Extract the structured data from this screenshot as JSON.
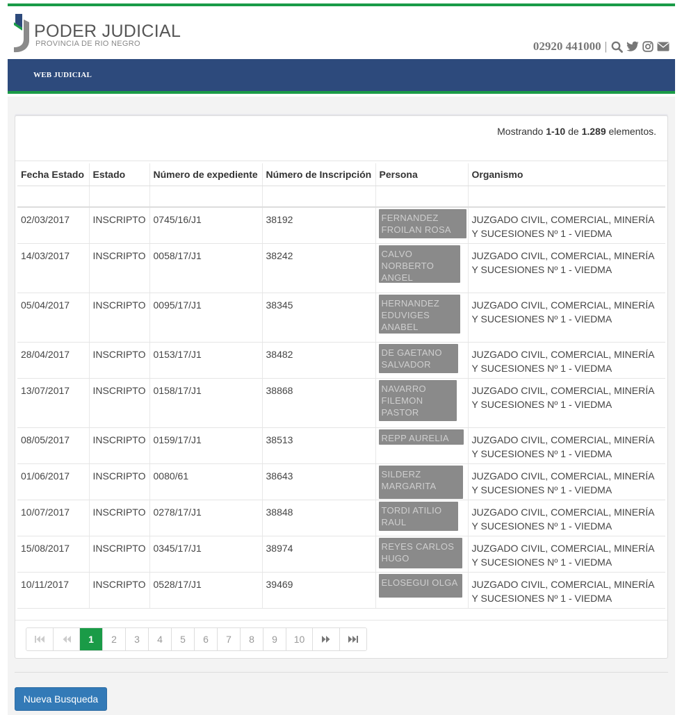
{
  "header": {
    "logo_title": "PODER JUDICIAL",
    "logo_subtitle": "PROVINCIA DE RIO NEGRO",
    "phone": "02920 441000",
    "separator": "|",
    "icons": [
      "search-icon",
      "twitter-icon",
      "instagram-icon",
      "envelope-icon"
    ]
  },
  "nav": {
    "web_judicial": "WEB JUDICIAL"
  },
  "summary": {
    "prefix": "Mostrando",
    "range": "1-10",
    "middle": "de",
    "total": "1.289",
    "suffix": "elementos."
  },
  "table": {
    "columns": [
      "Fecha Estado",
      "Estado",
      "Número de expediente",
      "Número de Inscripción",
      "Persona",
      "Organismo"
    ],
    "rows": [
      {
        "fecha": "02/03/2017",
        "estado": "INSCRIPTO",
        "expediente": "0745/16/J1",
        "inscripcion": "38192",
        "persona": "FERNANDEZ FROILAN ROSA",
        "organismo": "JUZGADO CIVIL, COMERCIAL, MINERÍA Y SUCESIONES Nº 1 - VIEDMA"
      },
      {
        "fecha": "14/03/2017",
        "estado": "INSCRIPTO",
        "expediente": "0058/17/J1",
        "inscripcion": "38242",
        "persona": "CALVO NORBERTO ANGEL",
        "organismo": "JUZGADO CIVIL, COMERCIAL, MINERÍA Y SUCESIONES Nº 1 - VIEDMA"
      },
      {
        "fecha": "05/04/2017",
        "estado": "INSCRIPTO",
        "expediente": "0095/17/J1",
        "inscripcion": "38345",
        "persona": "HERNANDEZ EDUVIGES ANABEL",
        "organismo": "JUZGADO CIVIL, COMERCIAL, MINERÍA Y SUCESIONES Nº 1 - VIEDMA"
      },
      {
        "fecha": "28/04/2017",
        "estado": "INSCRIPTO",
        "expediente": "0153/17/J1",
        "inscripcion": "38482",
        "persona": "DE GAETANO SALVADOR",
        "organismo": "JUZGADO CIVIL, COMERCIAL, MINERÍA Y SUCESIONES Nº 1 - VIEDMA"
      },
      {
        "fecha": "13/07/2017",
        "estado": "INSCRIPTO",
        "expediente": "0158/17/J1",
        "inscripcion": "38868",
        "persona": "NAVARRO FILEMON PASTOR",
        "organismo": "JUZGADO CIVIL, COMERCIAL, MINERÍA Y SUCESIONES Nº 1 - VIEDMA"
      },
      {
        "fecha": "08/05/2017",
        "estado": "INSCRIPTO",
        "expediente": "0159/17/J1",
        "inscripcion": "38513",
        "persona": "REPP AURELIA",
        "organismo": "JUZGADO CIVIL, COMERCIAL, MINERÍA Y SUCESIONES Nº 1 - VIEDMA"
      },
      {
        "fecha": "01/06/2017",
        "estado": "INSCRIPTO",
        "expediente": "0080/61",
        "inscripcion": "38643",
        "persona": "SILDERZ MARGARITA",
        "organismo": "JUZGADO CIVIL, COMERCIAL, MINERÍA Y SUCESIONES Nº 1 - VIEDMA"
      },
      {
        "fecha": "10/07/2017",
        "estado": "INSCRIPTO",
        "expediente": "0278/17/J1",
        "inscripcion": "38848",
        "persona": "TORDI ATILIO RAUL",
        "organismo": "JUZGADO CIVIL, COMERCIAL, MINERÍA Y SUCESIONES Nº 1 - VIEDMA"
      },
      {
        "fecha": "15/08/2017",
        "estado": "INSCRIPTO",
        "expediente": "0345/17/J1",
        "inscripcion": "38974",
        "persona": "REYES CARLOS HUGO",
        "organismo": "JUZGADO CIVIL, COMERCIAL, MINERÍA Y SUCESIONES Nº 1 - VIEDMA"
      },
      {
        "fecha": "10/11/2017",
        "estado": "INSCRIPTO",
        "expediente": "0528/17/J1",
        "inscripcion": "39469",
        "persona": "ELOSEGUI OLGA",
        "organismo": "JUZGADO CIVIL, COMERCIAL, MINERÍA Y SUCESIONES Nº 1 - VIEDMA"
      }
    ]
  },
  "pagination": {
    "pages": [
      "1",
      "2",
      "3",
      "4",
      "5",
      "6",
      "7",
      "8",
      "9",
      "10"
    ],
    "current": "1",
    "first_icon": "first-page-icon",
    "prev_icon": "prev-page-icon",
    "next_icon": "next-page-icon",
    "last_icon": "last-page-icon"
  },
  "actions": {
    "new_search": "Nueva Busqueda"
  },
  "colors": {
    "brand_green": "#1a9b47",
    "nav_blue": "#2d4a7c",
    "button_blue": "#337ab7"
  }
}
